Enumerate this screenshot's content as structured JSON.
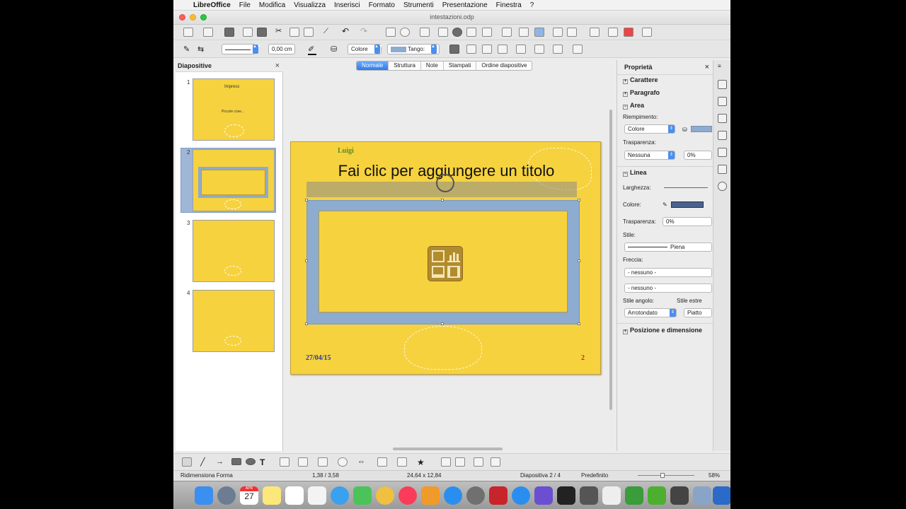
{
  "menubar": {
    "app": "LibreOffice",
    "items": [
      "File",
      "Modifica",
      "Visualizza",
      "Inserisci",
      "Formato",
      "Strumenti",
      "Presentazione",
      "Finestra",
      "?"
    ]
  },
  "window": {
    "title": "intestazioni.odp"
  },
  "toolbar2": {
    "line_width": "0,00 cm",
    "area_style": "Colore",
    "area_color": "Tango:"
  },
  "slides_pane": {
    "title": "Diapositive",
    "close": "×",
    "thumbs": [
      {
        "num": "1",
        "title": "Impress",
        "body": "Piccole cose...",
        "selected": false
      },
      {
        "num": "2",
        "selected": true
      },
      {
        "num": "3",
        "selected": false
      },
      {
        "num": "4",
        "selected": false
      }
    ]
  },
  "view_tabs": [
    "Normale",
    "Struttura",
    "Note",
    "Stampati",
    "Ordine diapositive"
  ],
  "slide": {
    "author": "Luigi",
    "title": "Fai clic per aggiungere un titolo",
    "date": "27/04/15",
    "number": "2"
  },
  "properties": {
    "title": "Proprietà",
    "close": "×",
    "sections": {
      "carattere": "Carattere",
      "paragrafo": "Paragrafo",
      "area": "Area",
      "linea": "Linea",
      "posizione": "Posizione e dimensione"
    },
    "area": {
      "fill_label": "Riempimento:",
      "fill_value": "Colore",
      "transparency_label": "Trasparenza:",
      "transparency_value": "Nessuna",
      "transparency_pct": "0%"
    },
    "line": {
      "width_label": "Larghezza:",
      "color_label": "Colore:",
      "transparency_label": "Trasparenza:",
      "transparency_value": "0%",
      "style_label": "Stile:",
      "style_value": "Piena",
      "arrow_label": "Freccia:",
      "arrow_start": "- nessuno -",
      "arrow_end": "- nessuno -",
      "corner_label": "Stile angolo:",
      "corner_value": "Arrotondato",
      "cap_label": "Stile estre",
      "cap_value": "Piatto"
    }
  },
  "status": {
    "action": "Ridimensiona Forma",
    "position": "1,38 / 3,58",
    "size": "24,64 x 12,84",
    "slide": "Diapositiva 2 / 4",
    "layout": "Predefinito",
    "zoom": "58%"
  },
  "dock": {
    "calendar_day": "27",
    "calendar_month": "APR"
  },
  "colors": {
    "slide_bg": "#f6d23f",
    "selection": "#8eabd0",
    "accent": "#2f7de8"
  }
}
